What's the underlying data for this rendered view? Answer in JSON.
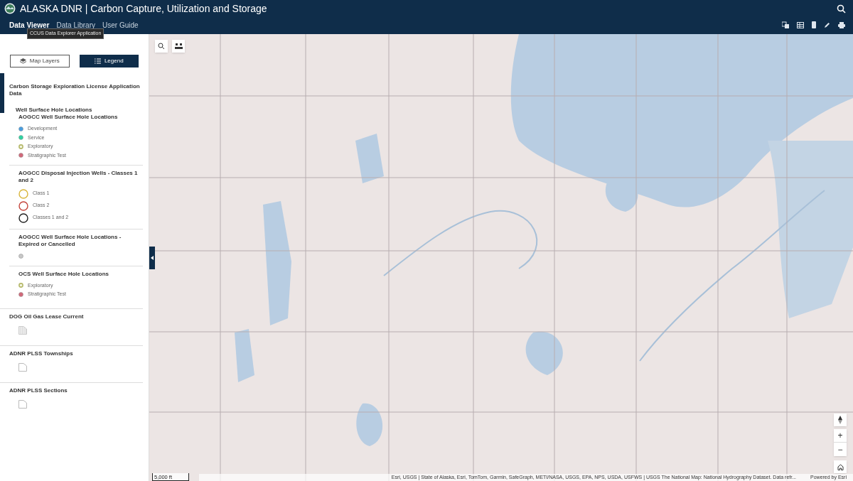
{
  "header": {
    "title": "ALASKA DNR | Carbon Capture, Utilization and Storage",
    "nav": [
      {
        "label": "Data Viewer",
        "selected": true
      },
      {
        "label": "Data Library",
        "selected": false
      },
      {
        "label": "User Guide",
        "selected": false
      }
    ],
    "tooltip": "CCUS Data Explorer Application"
  },
  "panel_tabs": [
    {
      "label": "Map Layers",
      "selected": false
    },
    {
      "label": "Legend",
      "selected": true
    }
  ],
  "legend": [
    {
      "title": "Carbon Storage Exploration License Application Data",
      "children": [
        {
          "title": "Well Surface Hole Locations",
          "children": [
            {
              "title": "AOGCC Well Surface Hole Locations",
              "symbols": [
                {
                  "kind": "dot",
                  "color": "#4a9fe0",
                  "label": "Development"
                },
                {
                  "kind": "dot",
                  "color": "#2fd3a2",
                  "label": "Service"
                },
                {
                  "kind": "hollow",
                  "color": "#b5b86a",
                  "label": "Exploratory"
                },
                {
                  "kind": "dot",
                  "color": "#d2697a",
                  "label": "Stratigraphic Test"
                }
              ]
            },
            {
              "title": "AOGCC Disposal Injection Wells - Classes 1 and 2",
              "symbols": [
                {
                  "kind": "ring",
                  "color": "#d9b63c",
                  "label": "Class 1"
                },
                {
                  "kind": "ring",
                  "color": "#c4453c",
                  "label": "Class 2"
                },
                {
                  "kind": "ring",
                  "color": "#222222",
                  "label": "Classes 1 and 2"
                }
              ]
            },
            {
              "title": "AOGCC Well Surface Hole Locations - Expired or Cancelled",
              "symbols": [
                {
                  "kind": "dot",
                  "color": "#c8c8c8"
                }
              ]
            },
            {
              "title": "OCS Well Surface Hole Locations",
              "symbols": [
                {
                  "kind": "hollow",
                  "color": "#b5b86a",
                  "label": "Exploratory"
                },
                {
                  "kind": "dot",
                  "color": "#d2697a",
                  "label": "Stratigraphic Test"
                }
              ]
            }
          ]
        }
      ]
    },
    {
      "title": "DOG Oil Gas Lease Current",
      "symbols": [
        {
          "kind": "hatch"
        }
      ]
    },
    {
      "title": "ADNR PLSS Townships",
      "symbols": [
        {
          "kind": "outline"
        }
      ]
    },
    {
      "title": "ADNR PLSS Sections",
      "symbols": [
        {
          "kind": "outline"
        }
      ]
    }
  ],
  "map": {
    "scale": "5,000 ft",
    "attribution": "Esri, USGS | State of Alaska, Esri, TomTom, Garmin, SafeGraph, METI/NASA, USGS, EPA, NPS, USDA, USFWS | USGS The National Map: National Hydrography Dataset. Data refr...",
    "powered_by": "Powered by Esri",
    "zoom_in": "+",
    "zoom_out": "−"
  }
}
